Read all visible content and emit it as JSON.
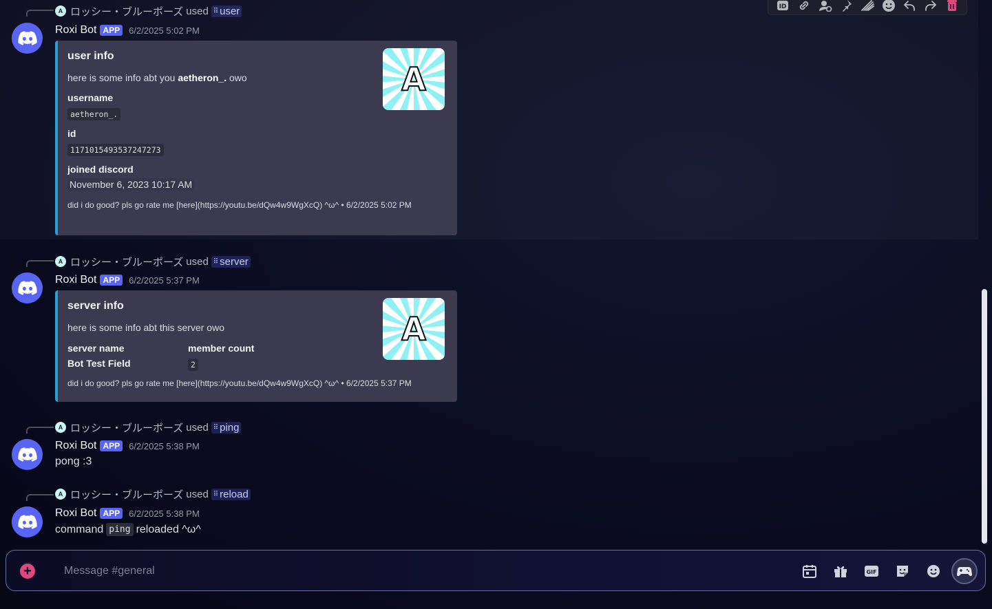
{
  "messages": [
    {
      "reply": {
        "avatar_letter": "A",
        "name": "ロッシー・ブルーポーズ",
        "used": "used",
        "command": "user"
      },
      "author": "Roxi Bot",
      "tag": "APP",
      "timestamp": "6/2/2025 5:02 PM",
      "embed": {
        "title": "user info",
        "desc_prefix": "here is some info abt you ",
        "desc_bold": "aetheron_.",
        "desc_suffix": " owo",
        "thumb_letter": "A",
        "fields": {
          "username_label": "username",
          "username_value": "aetheron_.",
          "id_label": "id",
          "id_value": "1171015493537247273",
          "joined_label": "joined discord",
          "joined_value": "November 6, 2023 10:17 AM"
        },
        "footer": "did i do good? pls go rate me [here](https://youtu.be/dQw4w9WgXcQ) ^ω^ • 6/2/2025 5:02 PM"
      }
    },
    {
      "reply": {
        "avatar_letter": "A",
        "name": "ロッシー・ブルーポーズ",
        "used": "used",
        "command": "server"
      },
      "author": "Roxi Bot",
      "tag": "APP",
      "timestamp": "6/2/2025 5:37 PM",
      "embed": {
        "title": "server info",
        "desc": "here is some info abt this server owo",
        "thumb_letter": "A",
        "fields": {
          "server_name_label": "server name",
          "server_name_value": "Bot Test Field",
          "member_count_label": "member count",
          "member_count_value": "2"
        },
        "footer": "did i do good? pls go rate me [here](https://youtu.be/dQw4w9WgXcQ) ^ω^ • 6/2/2025 5:37 PM"
      }
    },
    {
      "reply": {
        "avatar_letter": "A",
        "name": "ロッシー・ブルーポーズ",
        "used": "used",
        "command": "ping"
      },
      "author": "Roxi Bot",
      "tag": "APP",
      "timestamp": "6/2/2025 5:38 PM",
      "content": "pong :3"
    },
    {
      "reply": {
        "avatar_letter": "A",
        "name": "ロッシー・ブルーポーズ",
        "used": "used",
        "command": "reload"
      },
      "author": "Roxi Bot",
      "tag": "APP",
      "timestamp": "6/2/2025 5:38 PM",
      "content_prefix": "command",
      "content_code": "ping",
      "content_suffix": "reloaded ^ω^"
    }
  ],
  "toolbar_icons": [
    "id-icon",
    "link-icon",
    "user-reply-icon",
    "pin-icon",
    "signal-icon",
    "emoji-icon",
    "reply-icon",
    "forward-icon",
    "delete-icon"
  ],
  "composer": {
    "placeholder": "Message #general"
  },
  "colors": {
    "brand": "#5865f2",
    "embed_border": "#2a9fd6",
    "delete": "#e0477c"
  }
}
